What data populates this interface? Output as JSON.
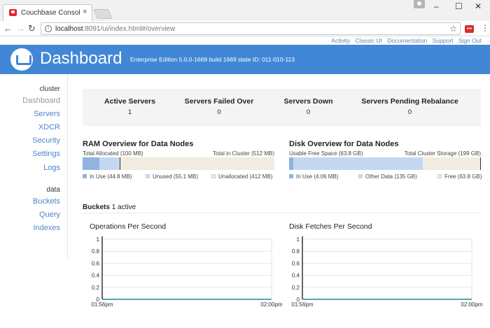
{
  "browser": {
    "tab_title": "Couchbase Console Ente",
    "tab_close": "×",
    "url_host": "localhost",
    "url_path": ":8091/ui/index.html#/overview",
    "ext_label": "•••"
  },
  "top_links": [
    "Activity",
    "Classic UI",
    "Documentation",
    "Support",
    "Sign Out"
  ],
  "header": {
    "title": "Dashboard",
    "build": "Enterprise Edition 5.0.0-1669 build 1669 state ID: 011-010-113",
    "color": "#4287d6"
  },
  "sidebar": {
    "section_cluster": "cluster",
    "cluster_items": [
      "Dashboard",
      "Servers",
      "XDCR",
      "Security",
      "Settings",
      "Logs"
    ],
    "section_data": "data",
    "data_items": [
      "Buckets",
      "Query",
      "Indexes"
    ]
  },
  "summary": [
    {
      "label": "Active Servers",
      "value": "1"
    },
    {
      "label": "Servers Failed Over",
      "value": "0"
    },
    {
      "label": "Servers Down",
      "value": "0"
    },
    {
      "label": "Servers Pending Rebalance",
      "value": "0"
    }
  ],
  "ram": {
    "title": "RAM Overview for Data Nodes",
    "left_label": "Total Allocated (100 MB)",
    "right_label": "Total in Cluster (512 MB)",
    "in_use_fraction": 0.0875,
    "unused_fraction": 0.1076,
    "legend": [
      {
        "label": "In Use (44.8 MB)",
        "color": "#8fb4de"
      },
      {
        "label": "Unused (55.1 MB)",
        "color": "#c3d8f0"
      },
      {
        "label": "Unallocated (412 MB)",
        "color": "#f0ece0"
      }
    ]
  },
  "disk": {
    "title": "Disk Overview for Data Nodes",
    "left_label": "Usable Free Space (63.8 GB)",
    "right_label": "Total Cluster Storage (199 GB)",
    "in_use_fraction": 0.0204,
    "other_fraction": 0.6784,
    "legend": [
      {
        "label": "In Use (4.06 MB)",
        "color": "#8fb4de"
      },
      {
        "label": "Other Data (135 GB)",
        "color": "#c3d8f0"
      },
      {
        "label": "Free (63.8 GB)",
        "color": "#f0ece0"
      }
    ]
  },
  "buckets": {
    "title": "Buckets",
    "count_text": "1 active"
  },
  "charts": {
    "ops_title": "Operations Per Second",
    "disk_title": "Disk Fetches Per Second"
  },
  "chart_data": [
    {
      "type": "line",
      "title": "Operations Per Second",
      "x": [
        "01:56pm",
        "02:00pm"
      ],
      "yticks": [
        "0",
        "0.2",
        "0.4",
        "0.6",
        "0.8",
        "1"
      ],
      "ylim": [
        0,
        1
      ],
      "series": [
        {
          "values": [
            0,
            0
          ]
        }
      ],
      "grid": true
    },
    {
      "type": "line",
      "title": "Disk Fetches Per Second",
      "x": [
        "01:56pm",
        "02:00pm"
      ],
      "yticks": [
        "0",
        "0.2",
        "0.4",
        "0.6",
        "0.8",
        "1"
      ],
      "ylim": [
        0,
        1
      ],
      "series": [
        {
          "values": [
            0,
            0
          ]
        }
      ],
      "grid": true
    }
  ]
}
